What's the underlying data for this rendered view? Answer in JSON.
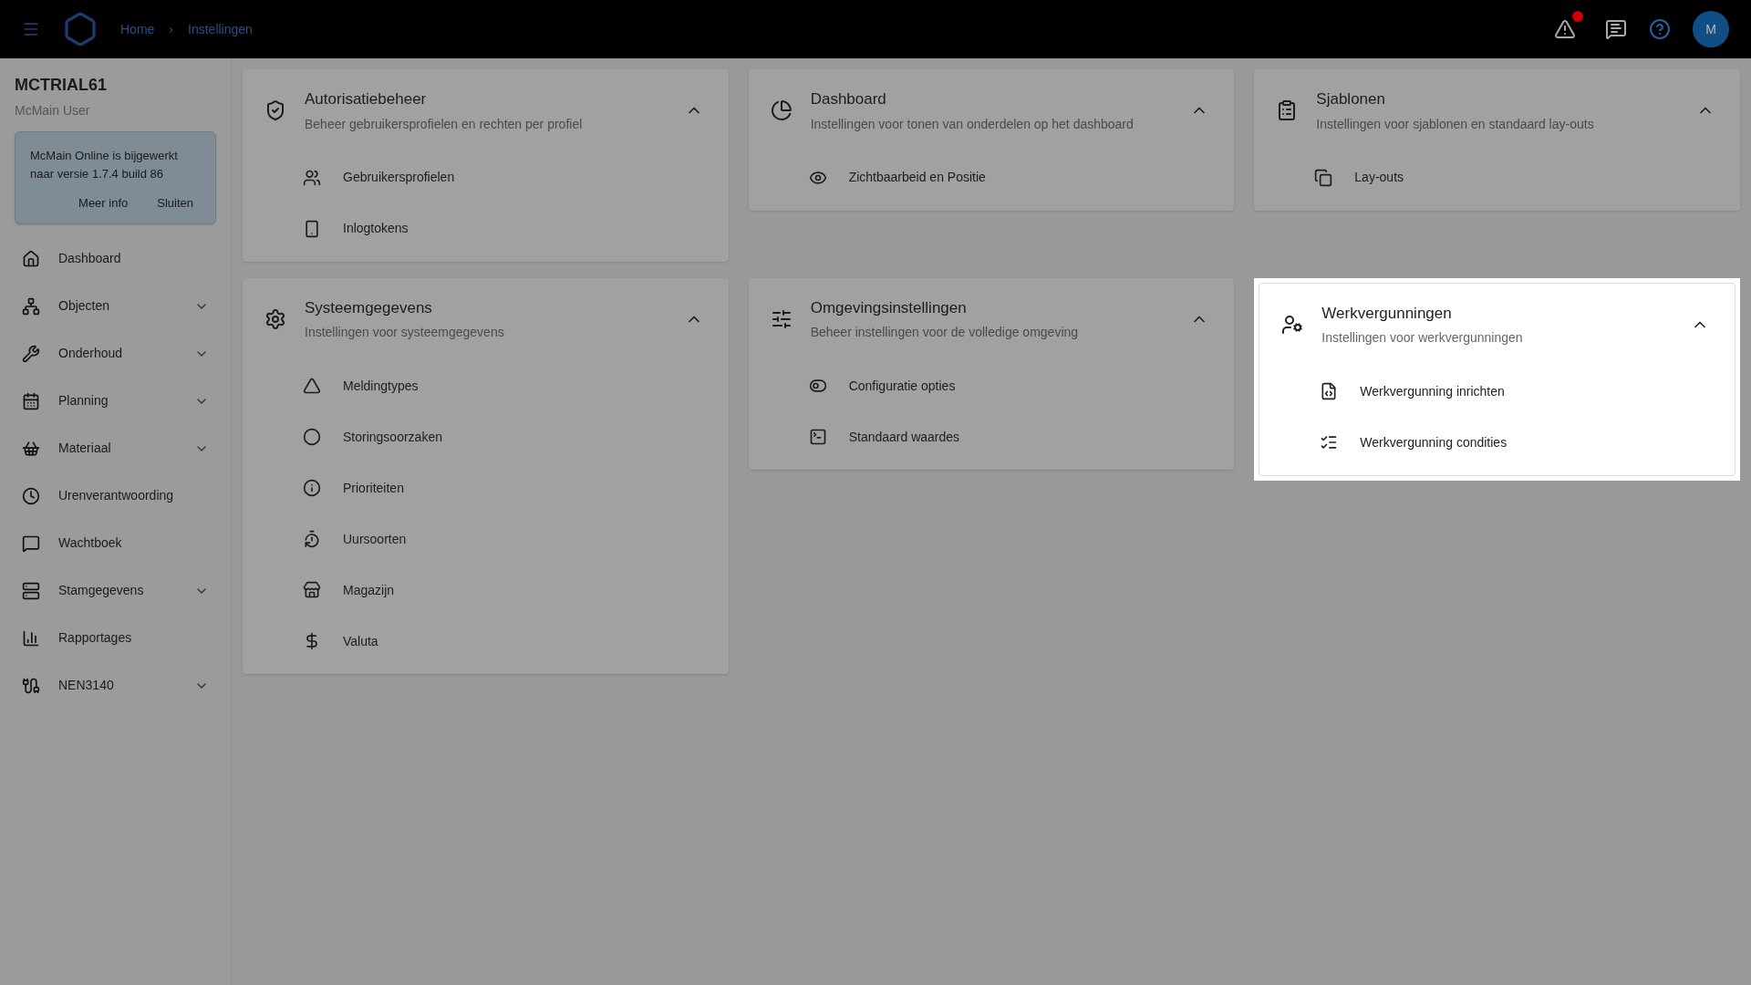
{
  "topbar": {
    "breadcrumb": [
      "Home",
      "Instellingen"
    ],
    "separator": "›",
    "alert_badge": true,
    "avatar": "M"
  },
  "sidebar": {
    "tenant": "MCTRIAL61",
    "user": "McMain User",
    "notice": {
      "text": "McMain Online is bijgewerkt naar versie 1.7.4 build 86",
      "actions": [
        "Meer info",
        "Sluiten"
      ]
    },
    "items": [
      {
        "label": "Dashboard",
        "expandable": false
      },
      {
        "label": "Objecten",
        "expandable": true
      },
      {
        "label": "Onderhoud",
        "expandable": true
      },
      {
        "label": "Planning",
        "expandable": true
      },
      {
        "label": "Materiaal",
        "expandable": true
      },
      {
        "label": "Urenverantwoording",
        "expandable": false
      },
      {
        "label": "Wachtboek",
        "expandable": false
      },
      {
        "label": "Stamgegevens",
        "expandable": true
      },
      {
        "label": "Rapportages",
        "expandable": false
      },
      {
        "label": "NEN3140",
        "expandable": true
      }
    ]
  },
  "cards": [
    {
      "title": "Autorisatiebeheer",
      "subtitle": "Beheer gebruikersprofielen en rechten per profiel",
      "expanded": true,
      "highlighted": false,
      "items": [
        "Gebruikersprofielen",
        "Inlogtokens"
      ]
    },
    {
      "title": "Dashboard",
      "subtitle": "Instellingen voor tonen van onderdelen op het dashboard",
      "expanded": true,
      "highlighted": false,
      "items": [
        "Zichtbaarbeid en Positie"
      ]
    },
    {
      "title": "Sjablonen",
      "subtitle": "Instellingen voor sjablonen en standaard lay-outs",
      "expanded": true,
      "highlighted": false,
      "items": [
        "Lay-outs"
      ]
    },
    {
      "title": "Systeemgegevens",
      "subtitle": "Instellingen voor systeemgegevens",
      "expanded": true,
      "highlighted": false,
      "items": [
        "Meldingtypes",
        "Storingsoorzaken",
        "Prioriteiten",
        "Uursoorten",
        "Magazijn",
        "Valuta"
      ]
    },
    {
      "title": "Omgevingsinstellingen",
      "subtitle": "Beheer instellingen voor de volledige omgeving",
      "expanded": true,
      "highlighted": false,
      "items": [
        "Configuratie opties",
        "Standaard waardes"
      ]
    },
    {
      "title": "Werkvergunningen",
      "subtitle": "Instellingen voor werkvergunningen",
      "expanded": true,
      "highlighted": true,
      "items": [
        "Werkvergunning inrichten",
        "Werkvergunning condities"
      ]
    }
  ]
}
